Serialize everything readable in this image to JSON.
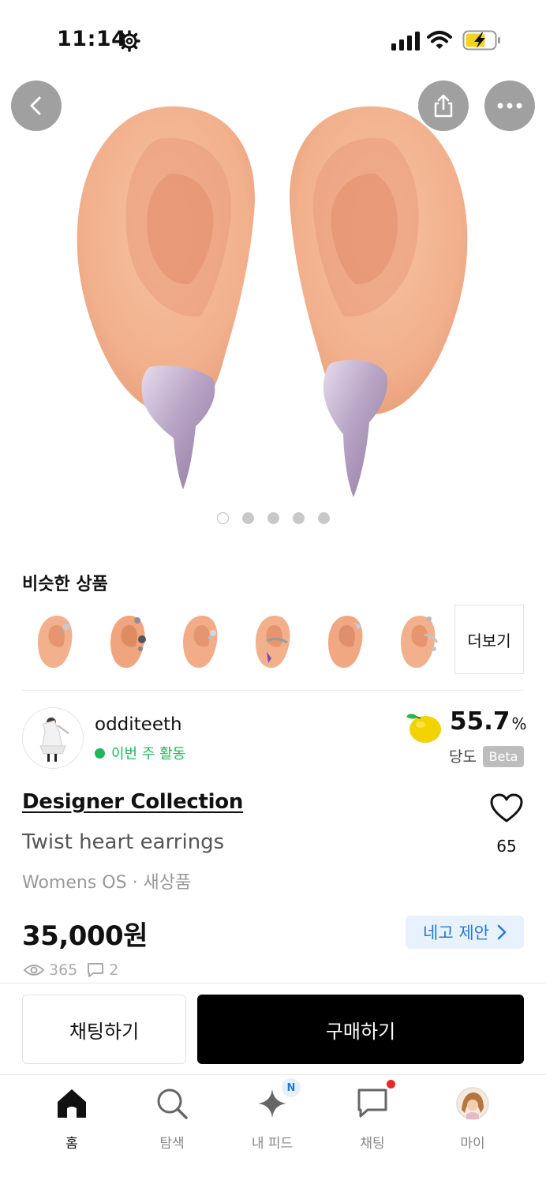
{
  "status": {
    "time": "11:14"
  },
  "gallery": {
    "dot_count": 5,
    "active_index": 0
  },
  "similar": {
    "title": "비슷한 상품",
    "more_label": "더보기",
    "thumbnails": [
      "earcuff-thumb-1",
      "earcuff-thumb-2",
      "earcuff-thumb-3",
      "earcuff-thumb-4",
      "earcuff-thumb-5",
      "earcuff-thumb-6"
    ]
  },
  "seller": {
    "name": "odditeeth",
    "activity": "이번 주 활동",
    "sweetness_value": "55.7",
    "sweetness_unit": "%",
    "sweetness_label": "당도",
    "beta_badge": "Beta"
  },
  "product": {
    "brand": "Designer Collection",
    "name": "Twist heart earrings",
    "meta": "Womens OS · 새상품",
    "likes": "65",
    "price": "35,000원",
    "offer_label": "네고 제안",
    "views": "365",
    "comments": "2"
  },
  "actions": {
    "chat": "채팅하기",
    "buy": "구매하기"
  },
  "tabs": [
    {
      "label": "홈",
      "icon": "home-icon",
      "active": true
    },
    {
      "label": "탐색",
      "icon": "search-icon",
      "active": false
    },
    {
      "label": "내 피드",
      "icon": "sparkle-icon",
      "active": false,
      "badge": "N"
    },
    {
      "label": "채팅",
      "icon": "chat-icon",
      "active": false
    },
    {
      "label": "마이",
      "icon": "profile-avatar-icon",
      "active": false
    }
  ],
  "colors": {
    "accent_green": "#1fb85a",
    "offer_blue": "#2478d6",
    "offer_bg": "#e8f2fd",
    "notification_red": "#e8262a"
  }
}
